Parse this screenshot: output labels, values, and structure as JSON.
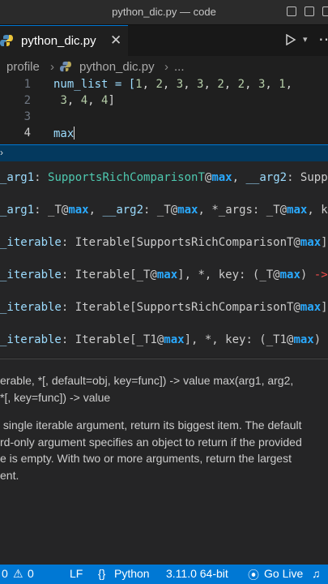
{
  "window": {
    "title": "python_dic.py — code"
  },
  "tab": {
    "label": "python_dic.py",
    "close": "✕"
  },
  "breadcrumbs": {
    "folder": "profile",
    "file": "python_dic.py",
    "more": "..."
  },
  "editor": {
    "lines": [
      {
        "num": "1",
        "parts": [
          "num_list = [",
          "1",
          ", ",
          "2",
          ", ",
          "3",
          ", ",
          "3",
          ", ",
          "2",
          ", ",
          "2",
          ", ",
          "3",
          ", ",
          "1",
          ","
        ]
      },
      {
        "num": "2",
        "parts": [
          " ",
          "3",
          ", ",
          "4",
          ", ",
          "4",
          "]"
        ]
      },
      {
        "num": "3",
        "parts": []
      },
      {
        "num": "4",
        "parts": [
          "max"
        ]
      }
    ]
  },
  "suggest": {
    "chevron": "›"
  },
  "overloads": [
    {
      "segments": [
        {
          "t": "_arg1",
          "c": "param"
        },
        {
          "t": ": ",
          "c": ""
        },
        {
          "t": "SupportsRichComparisonT",
          "c": "type"
        },
        {
          "t": "@",
          "c": ""
        },
        {
          "t": "max",
          "c": "hl"
        },
        {
          "t": ", ",
          "c": ""
        },
        {
          "t": "__arg2",
          "c": "param"
        },
        {
          "t": ": Suppo",
          "c": ""
        }
      ]
    },
    {
      "segments": [
        {
          "t": "_arg1",
          "c": "param"
        },
        {
          "t": ": _T@",
          "c": ""
        },
        {
          "t": "max",
          "c": "hl"
        },
        {
          "t": ", ",
          "c": ""
        },
        {
          "t": "__arg2",
          "c": "param"
        },
        {
          "t": ": _T@",
          "c": ""
        },
        {
          "t": "max",
          "c": "hl"
        },
        {
          "t": ", *_args: _T@",
          "c": ""
        },
        {
          "t": "max",
          "c": "hl"
        },
        {
          "t": ", ke",
          "c": ""
        }
      ]
    },
    {
      "segments": [
        {
          "t": "_iterable",
          "c": "param"
        },
        {
          "t": ": Iterable[SupportsRichComparisonT@",
          "c": ""
        },
        {
          "t": "max",
          "c": "hl"
        },
        {
          "t": "],",
          "c": ""
        }
      ]
    },
    {
      "segments": [
        {
          "t": "_iterable",
          "c": "param"
        },
        {
          "t": ": Iterable[_T@",
          "c": ""
        },
        {
          "t": "max",
          "c": "hl"
        },
        {
          "t": "], *, key: (_T@",
          "c": ""
        },
        {
          "t": "max",
          "c": "hl"
        },
        {
          "t": ") ",
          "c": ""
        },
        {
          "t": "->",
          "c": "arrow"
        }
      ]
    },
    {
      "segments": [
        {
          "t": "_iterable",
          "c": "param"
        },
        {
          "t": ": Iterable[SupportsRichComparisonT@",
          "c": ""
        },
        {
          "t": "max",
          "c": "hl"
        },
        {
          "t": "],",
          "c": ""
        }
      ]
    },
    {
      "segments": [
        {
          "t": "_iterable",
          "c": "param"
        },
        {
          "t": ": Iterable[_T1@",
          "c": ""
        },
        {
          "t": "max",
          "c": "hl"
        },
        {
          "t": "], *, key: (_T1@",
          "c": ""
        },
        {
          "t": "max",
          "c": "hl"
        },
        {
          "t": ") ",
          "c": ""
        },
        {
          "t": "-",
          "c": "arrow"
        }
      ]
    }
  ],
  "docs": {
    "signature": "erable, *[, default=obj, key=func]) -> value max(arg1, arg2,\n*[, key=func]) -> value",
    "description": " single iterable argument, return its biggest item. The default\nrd-only argument specifies an object to return if the provided\ne is empty. With two or more arguments, return the largest\nent."
  },
  "status": {
    "problems": "0",
    "warnings": "0",
    "eol": "LF",
    "language": "Python",
    "interpreter": "3.11.0 64-bit",
    "golive": "Go Live"
  },
  "colors": {
    "accent": "#0078d4",
    "highlight": "#2aaaff"
  }
}
